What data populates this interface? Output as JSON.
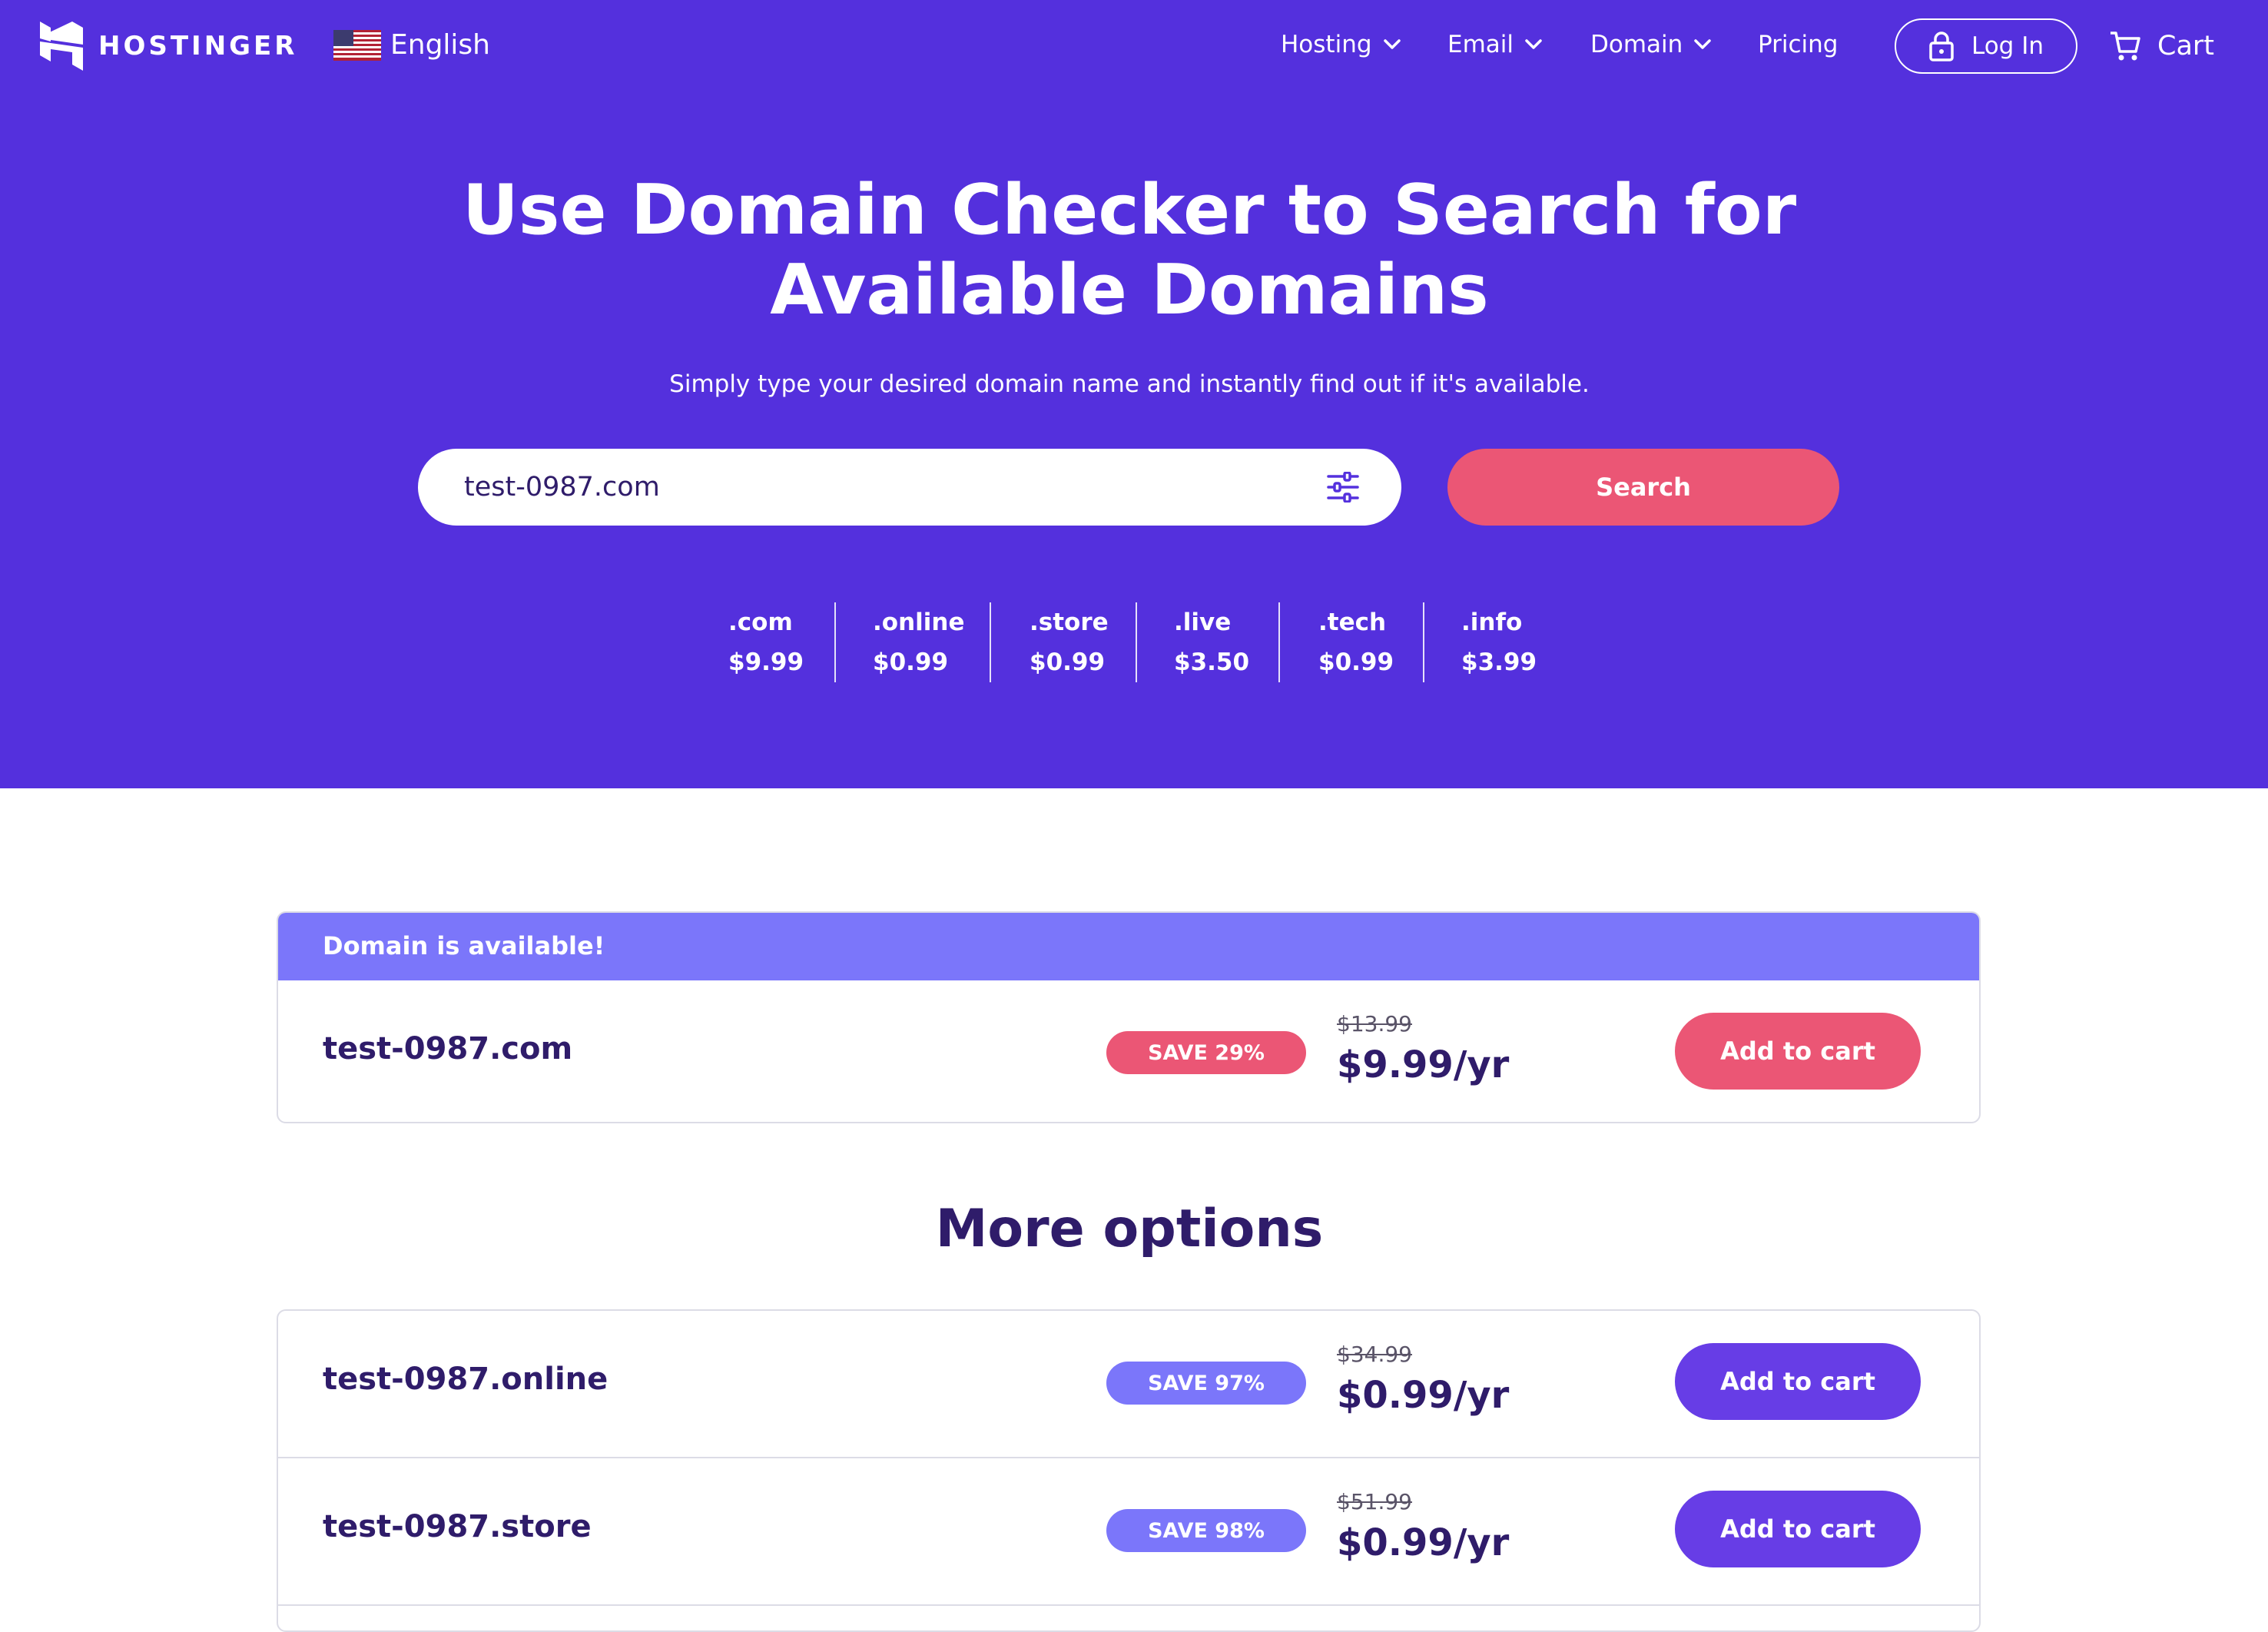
{
  "brand": {
    "name": "HOSTINGER"
  },
  "language": {
    "label": "English"
  },
  "nav": {
    "hosting": "Hosting",
    "email": "Email",
    "domain": "Domain",
    "pricing": "Pricing",
    "login": "Log In",
    "cart": "Cart"
  },
  "hero": {
    "title_line1": "Use Domain Checker to Search for",
    "title_line2": "Available Domains",
    "subtitle": "Simply type your desired domain name and instantly find out if it's available."
  },
  "search": {
    "value": "test-0987.com",
    "button": "Search"
  },
  "tlds": [
    {
      "name": ".com",
      "price": "$9.99"
    },
    {
      "name": ".online",
      "price": "$0.99"
    },
    {
      "name": ".store",
      "price": "$0.99"
    },
    {
      "name": ".live",
      "price": "$3.50"
    },
    {
      "name": ".tech",
      "price": "$0.99"
    },
    {
      "name": ".info",
      "price": "$3.99"
    }
  ],
  "available": {
    "header": "Domain is available!",
    "domain": "test-0987.com",
    "badge": "SAVE 29%",
    "old_price": "$13.99",
    "price": "$9.99/yr",
    "cta": "Add to cart"
  },
  "more": {
    "title": "More options",
    "items": [
      {
        "domain": "test-0987.online",
        "badge": "SAVE 97%",
        "old_price": "$34.99",
        "price": "$0.99/yr",
        "cta": "Add to cart"
      },
      {
        "domain": "test-0987.store",
        "badge": "SAVE 98%",
        "old_price": "$51.99",
        "price": "$0.99/yr",
        "cta": "Add to cart"
      }
    ]
  },
  "colors": {
    "hero_bg": "#5430dd",
    "accent_pink": "#eb5675",
    "accent_purple": "#673de6",
    "badge_purple": "#7b76fa",
    "text_dark": "#2f1c6a"
  },
  "icons": [
    "hostinger-logo-icon",
    "us-flag-icon",
    "chevron-down-icon",
    "lock-icon",
    "cart-icon",
    "filter-icon"
  ]
}
